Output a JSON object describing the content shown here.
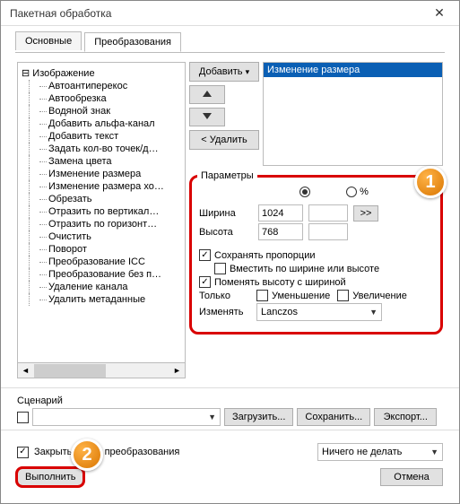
{
  "window": {
    "title": "Пакетная обработка"
  },
  "tabs": {
    "main": "Основные",
    "transforms": "Преобразования"
  },
  "tree": {
    "root": "Изображение",
    "items": [
      "Автоантиперекос",
      "Автообрезка",
      "Водяной знак",
      "Добавить альфа-канал",
      "Добавить текст",
      "Задать кол-во точек/д…",
      "Замена цвета",
      "Изменение размера",
      "Изменение размера хо…",
      "Обрезать",
      "Отразить по вертикал…",
      "Отразить по горизонт…",
      "Очистить",
      "Поворот",
      "Преобразование ICC",
      "Преобразование без п…",
      "Удаление канала",
      "Удалить метаданные"
    ]
  },
  "rightList": {
    "item": "Изменение размера"
  },
  "buttons": {
    "add": "Добавить",
    "addDrop": "▾",
    "remove": "< Удалить",
    "load": "Загрузить...",
    "save": "Сохранить...",
    "export": "Экспорт...",
    "execute": "Выполнить",
    "cancel": "Отмена",
    "go": ">>"
  },
  "params": {
    "legend": "Параметры",
    "radioPercent": "%",
    "widthLabel": "Ширина",
    "heightLabel": "Высота",
    "widthVal": "1024",
    "heightVal": "768",
    "keepRatio": "Сохранять пропорции",
    "fit": "Вместить по ширине или высоте",
    "swap": "Поменять высоту с шириной",
    "only": "Только",
    "shrink": "Уменьшение",
    "enlarge": "Увеличение",
    "resampleLabel": "Изменять",
    "resampleValue": "Lanczos"
  },
  "scenario": {
    "label": "Сценарий"
  },
  "bottom": {
    "closeAfter": "Закрыть после преобразования",
    "actionValue": "Ничего не делать"
  },
  "badges": {
    "one": "1",
    "two": "2"
  }
}
